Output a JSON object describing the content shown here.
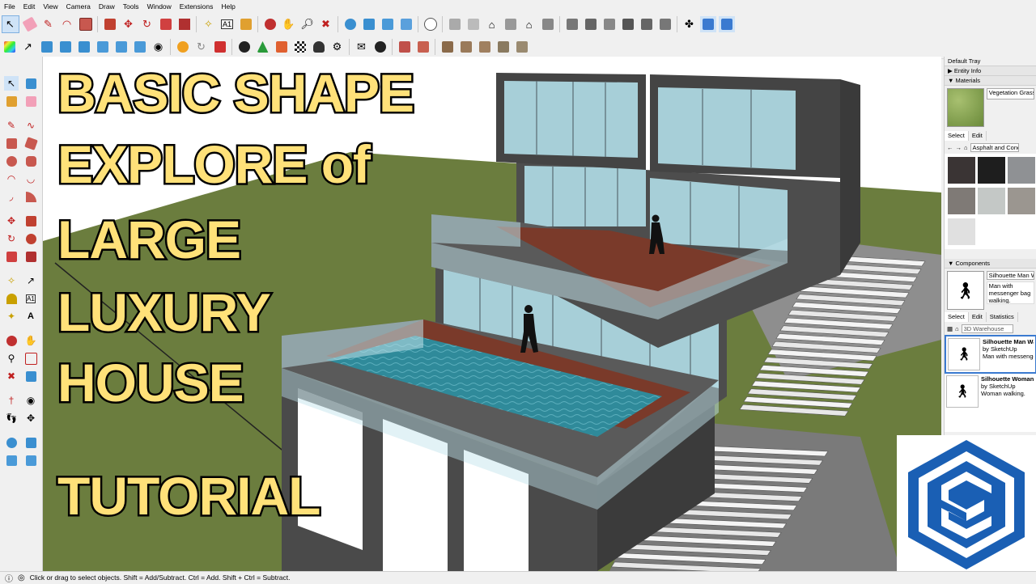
{
  "menubar": {
    "items": [
      "File",
      "Edit",
      "View",
      "Camera",
      "Draw",
      "Tools",
      "Window",
      "Extensions",
      "Help"
    ]
  },
  "title": {
    "lines": [
      "BASIC SHAPE",
      "EXPLORE of",
      "LARGE",
      "LUXURY",
      "HOUSE",
      "TUTORIAL"
    ]
  },
  "tray": {
    "title": "Default Tray",
    "entity_info": "Entity Info",
    "materials": {
      "header": "Materials",
      "current_name": "Vegetation Grass",
      "tabs": [
        "Select",
        "Edit"
      ],
      "collection": "Asphalt and Concrete",
      "swatch_colors": [
        "#3a3434",
        "#1e1e1e",
        "#8f9194",
        "#7f7a76",
        "#c4c8c6",
        "#9b9690",
        "#e0e0e0"
      ]
    },
    "components": {
      "header": "Components",
      "current_name": "Silhouette Man Walking",
      "current_desc": "Man with messenger bag walking.",
      "tabs": [
        "Select",
        "Edit",
        "Statistics"
      ],
      "search": "3D Warehouse",
      "list": [
        {
          "title": "Silhouette Man Walking",
          "by": "by SketchUp",
          "desc": "Man with messenger bag"
        },
        {
          "title": "Silhouette Woman",
          "by": "by SketchUp",
          "desc": "Woman walking."
        }
      ]
    }
  },
  "status": {
    "text": "Click or drag to select objects. Shift = Add/Subtract. Ctrl = Add. Shift + Ctrl = Subtract."
  },
  "colors": {
    "title_fill": "#ffe179",
    "grass": "#6b7d3e",
    "sky": "#ffffff",
    "pool": "#2f8a9a",
    "deck": "#7a3a2a",
    "wall": "#4a4a4a",
    "logo_blue": "#1a5fb4"
  }
}
